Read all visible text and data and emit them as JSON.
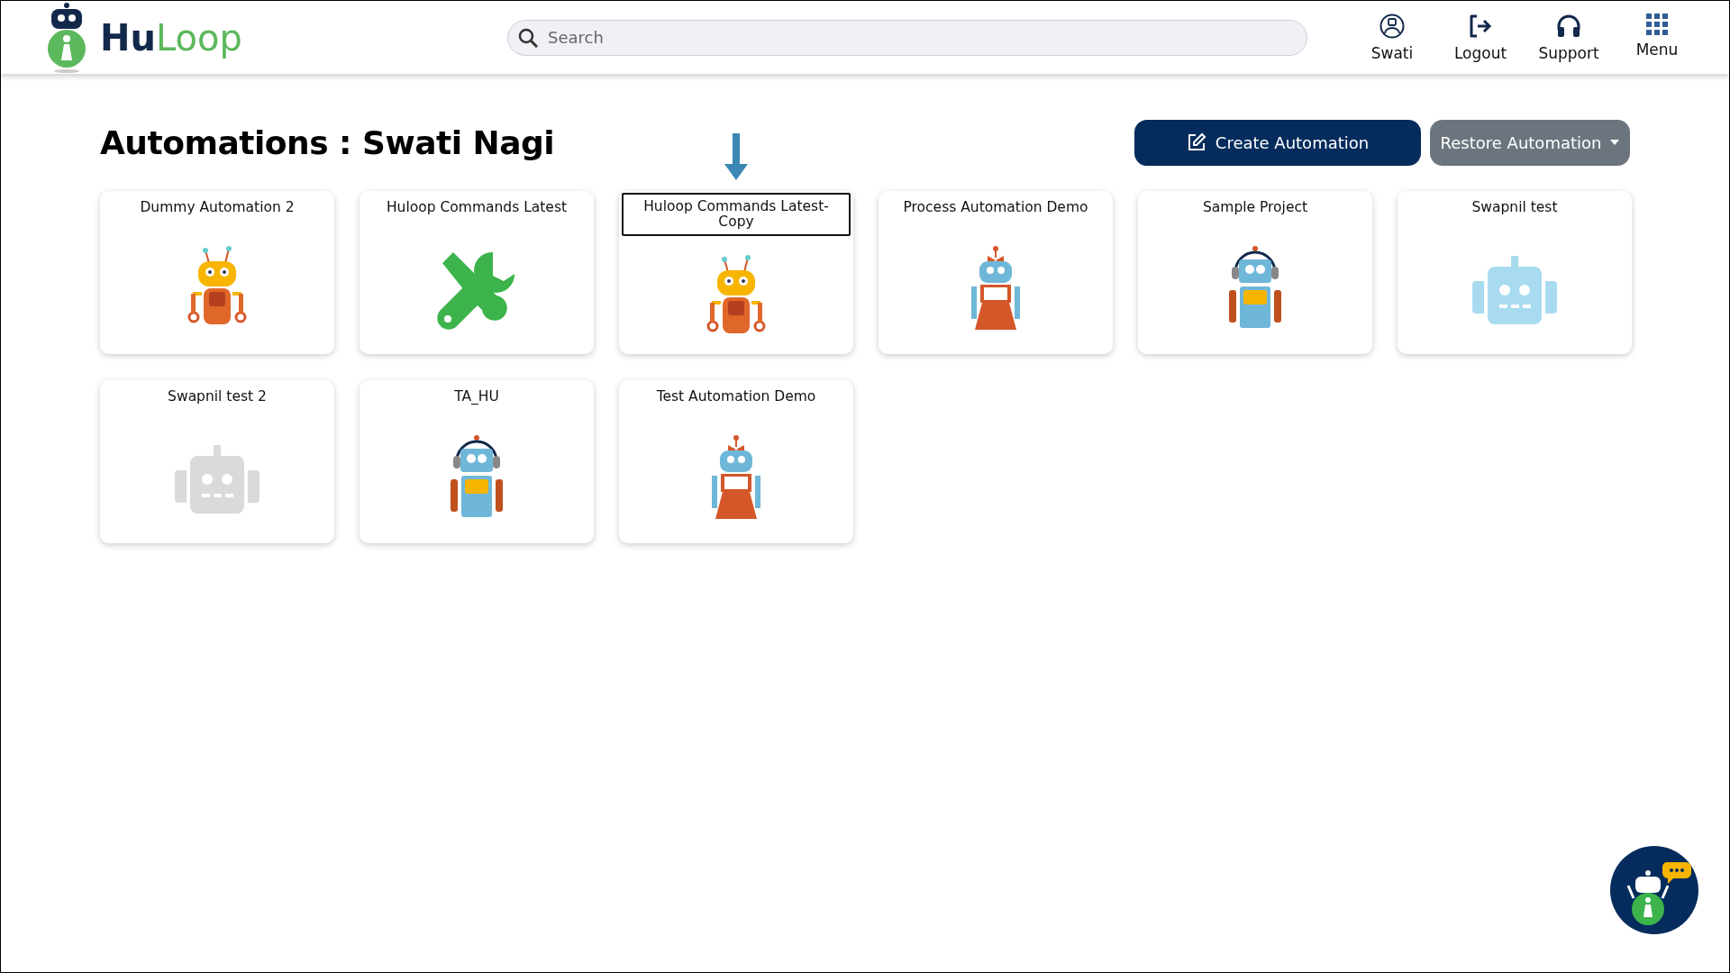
{
  "header": {
    "logo": {
      "part_1": "Hu",
      "part_2": "Loop"
    },
    "search": {
      "placeholder": "Search"
    },
    "nav": [
      {
        "kind": "user",
        "label": "Swati"
      },
      {
        "kind": "logout",
        "label": "Logout"
      },
      {
        "kind": "support",
        "label": "Support"
      },
      {
        "kind": "menu",
        "label": "Menu"
      }
    ]
  },
  "page_title": "Automations : Swati Nagi",
  "buttons": [
    {
      "kind": "create",
      "label": "Create Automation"
    },
    {
      "kind": "restore",
      "label": "Restore Automation"
    }
  ],
  "automations": [
    {
      "title": "Dummy Automation 2",
      "kind": "orange-robot",
      "highlighted": false
    },
    {
      "title": "Huloop Commands Latest",
      "kind": "tools",
      "highlighted": false
    },
    {
      "title": "Huloop Commands Latest-Copy",
      "kind": "orange-robot",
      "highlighted": true
    },
    {
      "title": "Process Automation Demo",
      "kind": "girl-robot",
      "highlighted": false
    },
    {
      "title": "Sample Project",
      "kind": "headset-robot",
      "highlighted": false
    },
    {
      "title": "Swapnil test",
      "kind": "plain-robot",
      "color": "#a8dbf0",
      "highlighted": false
    },
    {
      "title": "Swapnil test 2",
      "kind": "plain-robot",
      "color": "#d9dadc",
      "highlighted": false
    },
    {
      "title": "TA_HU",
      "kind": "headset-robot",
      "highlighted": false
    },
    {
      "title": "Test Automation Demo",
      "kind": "girl-robot",
      "highlighted": false
    }
  ]
}
